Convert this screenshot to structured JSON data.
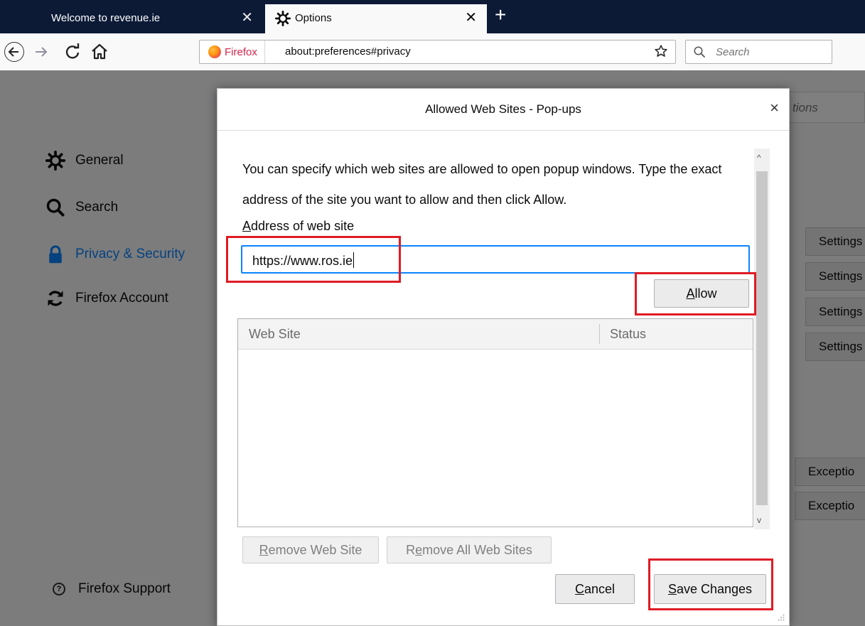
{
  "browser": {
    "tabs": [
      {
        "label": "Welcome to revenue.ie",
        "active": false
      },
      {
        "label": "Options",
        "active": true
      }
    ],
    "new_tab_glyph": "+",
    "close_glyph": "✕",
    "identity_label": "Firefox",
    "url": "about:preferences#privacy",
    "search_placeholder": "Search",
    "icons": {
      "back": "back-arrow-icon",
      "forward": "forward-arrow-icon",
      "reload": "reload-icon",
      "home": "home-icon",
      "bookmark": "star-icon",
      "search": "magnifier-icon",
      "firefox": "firefox-logo-icon"
    }
  },
  "preferences": {
    "sidebar": [
      {
        "label": "General",
        "icon": "gear-icon",
        "active": false
      },
      {
        "label": "Search",
        "icon": "magnifier-icon",
        "active": false
      },
      {
        "label": "Privacy & Security",
        "icon": "lock-icon",
        "active": true
      },
      {
        "label": "Firefox Account",
        "icon": "sync-icon",
        "active": false
      }
    ],
    "support_label": "Firefox Support",
    "find_placeholder_partial": "tions",
    "right_buttons": [
      "Settings",
      "Settings",
      "Settings",
      "Settings",
      "Exceptio",
      "Exceptio"
    ]
  },
  "dialog": {
    "title": "Allowed Web Sites - Pop-ups",
    "close_glyph": "×",
    "description": "You can specify which web sites are allowed to open popup windows. Type the exact address of the site you want to allow and then click Allow.",
    "address_label": "Address of web site",
    "address_value": "https://www.ros.ie",
    "allow_label": "Allow",
    "columns": [
      "Web Site",
      "Status"
    ],
    "rows": [],
    "remove_label": "Remove Web Site",
    "remove_all_label": "Remove All Web Sites",
    "cancel_label": "Cancel",
    "save_label": "Save Changes",
    "scroll_up_glyph": "^",
    "scroll_down_glyph": "v"
  },
  "colors": {
    "titlebar": "#0c1a36",
    "accent": "#0a84ff",
    "highlight": "#e01b24"
  }
}
